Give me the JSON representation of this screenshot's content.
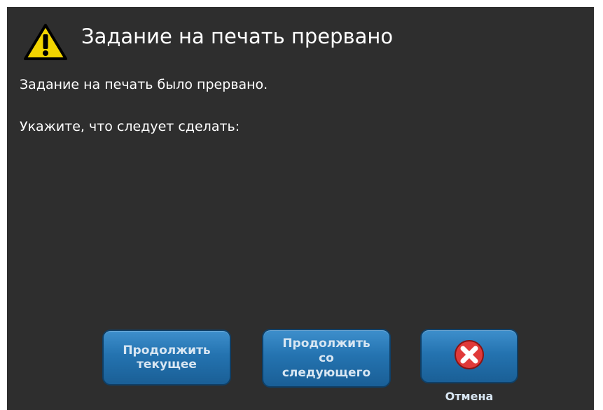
{
  "dialog": {
    "title": "Задание на печать прервано",
    "icon": "warning-icon",
    "message_line1": "Задание на печать было прервано.",
    "message_line2": "Укажите, что следует сделать:"
  },
  "buttons": {
    "continue_current": {
      "line1": "Продолжить",
      "line2": "текущее"
    },
    "continue_next": {
      "line1": "Продолжить",
      "line2": "со",
      "line3": "следующего"
    },
    "cancel": {
      "icon": "close-icon",
      "label": "Отмена"
    }
  },
  "colors": {
    "dialog_bg": "#2e2e2e",
    "button_blue": "#2473b0",
    "warning_yellow": "#f2d400",
    "cancel_red": "#e03a3a"
  }
}
